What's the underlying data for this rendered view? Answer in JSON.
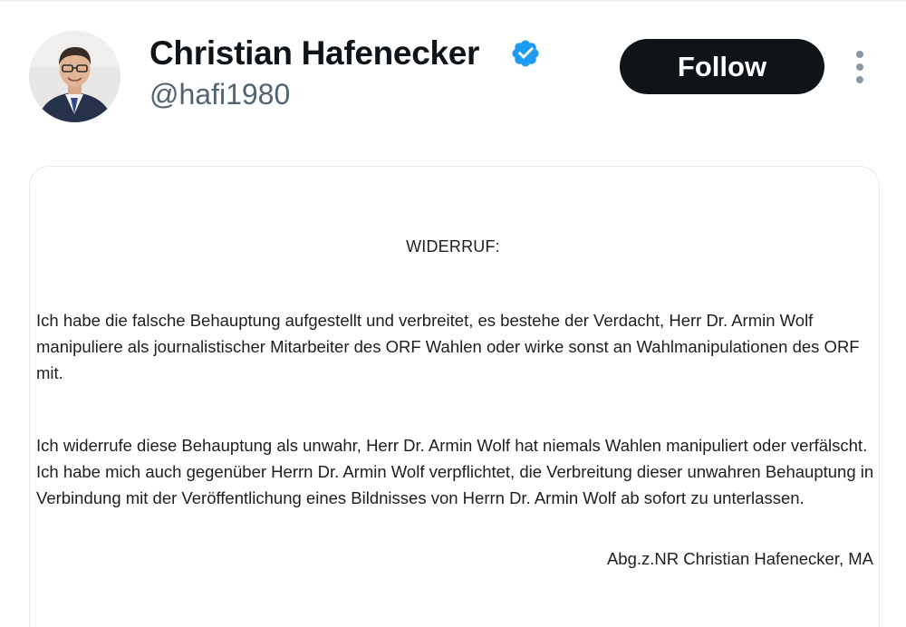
{
  "profile": {
    "display_name": "Christian Hafenecker",
    "handle": "@hafi1980",
    "verified": true,
    "verified_color": "#1d9bf0"
  },
  "actions": {
    "follow_label": "Follow",
    "more_icon": "vertical-ellipsis-icon"
  },
  "document": {
    "title": "WIDERRUF:",
    "paragraph_1": "Ich habe die falsche Behauptung aufgestellt und verbreitet, es bestehe der Verdacht, Herr Dr. Armin Wolf manipuliere als journalistischer Mitarbeiter des ORF Wahlen oder wirke sonst an Wahlmanipulationen des ORF mit.",
    "paragraph_2": "Ich widerrufe diese Behauptung als unwahr, Herr Dr. Armin Wolf hat niemals Wahlen manipuliert oder verfälscht. Ich habe mich auch gegenüber Herrn Dr. Armin Wolf verpflichtet, die Verbreitung dieser unwahren Behauptung in Verbindung mit der Veröffentlichung eines Bildnisses von Herrn Dr. Armin Wolf ab sofort zu unterlassen.",
    "signature": "Abg.z.NR Christian Hafenecker, MA"
  },
  "colors": {
    "text_primary": "#0f1419",
    "text_secondary": "#536471",
    "button_bg": "#0f1419",
    "button_text": "#ffffff",
    "card_border": "#e5e9eb"
  }
}
